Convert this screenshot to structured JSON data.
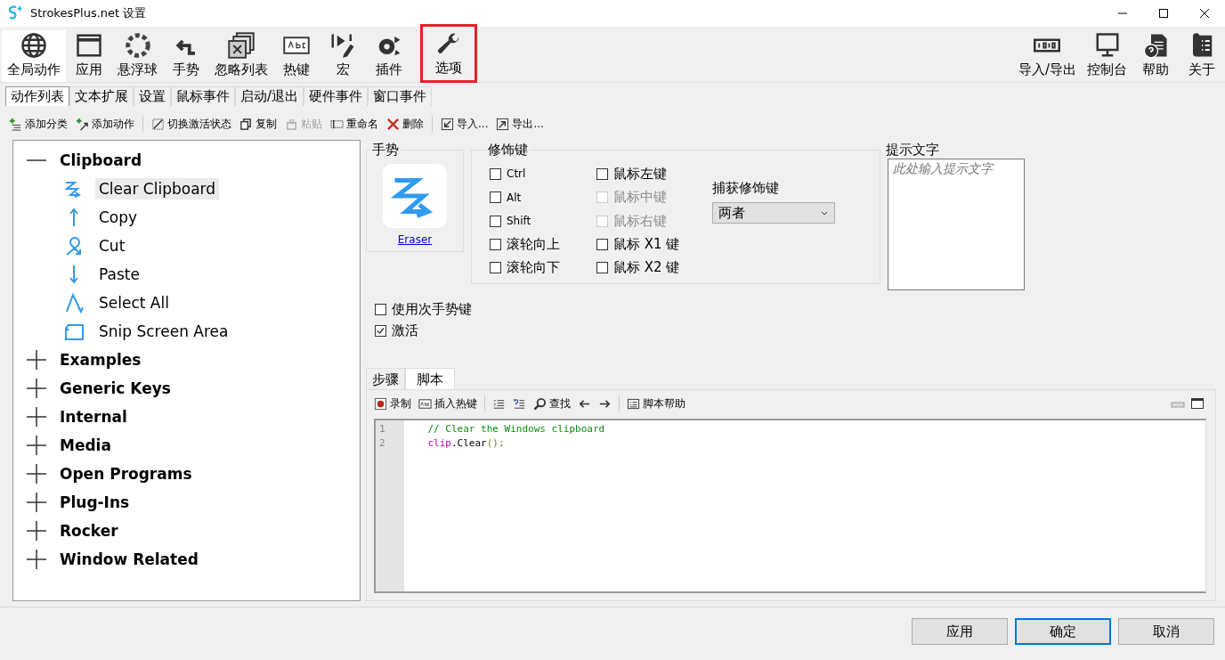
{
  "window": {
    "title": "StrokesPlus.net 设置"
  },
  "toolbar": [
    {
      "label": "全局动作",
      "selected": true,
      "highlighted": false
    },
    {
      "label": "应用",
      "selected": false,
      "highlighted": false
    },
    {
      "label": "悬浮球",
      "selected": false,
      "highlighted": false
    },
    {
      "label": "手势",
      "selected": false,
      "highlighted": false
    },
    {
      "label": "忽略列表",
      "selected": false,
      "highlighted": false
    },
    {
      "label": "热键",
      "selected": false,
      "highlighted": false
    },
    {
      "label": "宏",
      "selected": false,
      "highlighted": false
    },
    {
      "label": "插件",
      "selected": false,
      "highlighted": false
    },
    {
      "label": "选项",
      "selected": false,
      "highlighted": true
    }
  ],
  "toolbar_right": [
    {
      "label": "导入/导出"
    },
    {
      "label": "控制台"
    },
    {
      "label": "帮助"
    },
    {
      "label": "关于"
    }
  ],
  "tabs": [
    {
      "label": "动作列表",
      "selected": true
    },
    {
      "label": "文本扩展",
      "selected": false
    },
    {
      "label": "设置",
      "selected": false
    },
    {
      "label": "鼠标事件",
      "selected": false
    },
    {
      "label": "启动/退出",
      "selected": false
    },
    {
      "label": "硬件事件",
      "selected": false
    },
    {
      "label": "窗口事件",
      "selected": false
    }
  ],
  "actions": [
    {
      "label": "添加分类",
      "disabled": false
    },
    {
      "label": "添加动作",
      "disabled": false
    },
    {
      "label": "切换激活状态",
      "disabled": false
    },
    {
      "label": "复制",
      "disabled": false
    },
    {
      "label": "粘贴",
      "disabled": true
    },
    {
      "label": "重命名",
      "disabled": false
    },
    {
      "label": "删除",
      "disabled": false
    },
    {
      "label": "导入...",
      "disabled": false
    },
    {
      "label": "导出...",
      "disabled": false
    }
  ],
  "tree": [
    {
      "label": "Clipboard",
      "expanded": true,
      "children": [
        {
          "label": "Clear Clipboard",
          "selected": true
        },
        {
          "label": "Copy",
          "selected": false
        },
        {
          "label": "Cut",
          "selected": false
        },
        {
          "label": "Paste",
          "selected": false
        },
        {
          "label": "Select All",
          "selected": false
        },
        {
          "label": "Snip Screen Area",
          "selected": false
        }
      ]
    },
    {
      "label": "Examples",
      "expanded": false
    },
    {
      "label": "Generic Keys",
      "expanded": false
    },
    {
      "label": "Internal",
      "expanded": false
    },
    {
      "label": "Media",
      "expanded": false
    },
    {
      "label": "Open Programs",
      "expanded": false
    },
    {
      "label": "Plug-Ins",
      "expanded": false
    },
    {
      "label": "Rocker",
      "expanded": false
    },
    {
      "label": "Window Related",
      "expanded": false
    }
  ],
  "gesture": {
    "title": "手势",
    "link": "Eraser"
  },
  "modifiers": {
    "title": "修饰键",
    "items": [
      {
        "label": "Ctrl",
        "checked": false,
        "disabled": false
      },
      {
        "label": "Alt",
        "checked": false,
        "disabled": false
      },
      {
        "label": "Shift",
        "checked": false,
        "disabled": false
      },
      {
        "label": "滚轮向上",
        "checked": false,
        "disabled": false
      },
      {
        "label": "滚轮向下",
        "checked": false,
        "disabled": false
      },
      {
        "label": "鼠标左键",
        "checked": false,
        "disabled": false
      },
      {
        "label": "鼠标中键",
        "checked": false,
        "disabled": true
      },
      {
        "label": "鼠标右键",
        "checked": false,
        "disabled": true
      },
      {
        "label": "鼠标 X1 键",
        "checked": false,
        "disabled": false
      },
      {
        "label": "鼠标 X2 键",
        "checked": false,
        "disabled": false
      }
    ]
  },
  "capture": {
    "label": "捕获修饰键",
    "value": "两者"
  },
  "hint": {
    "title": "提示文字",
    "placeholder": "此处输入提示文字"
  },
  "options": [
    {
      "label": "使用次手势键",
      "checked": false
    },
    {
      "label": "激活",
      "checked": true
    }
  ],
  "script_tabs": [
    {
      "label": "步骤",
      "selected": false
    },
    {
      "label": "脚本",
      "selected": true
    }
  ],
  "script_tools": [
    {
      "kind": "labeled",
      "label": "录制"
    },
    {
      "kind": "labeled",
      "label": "插入热键"
    },
    {
      "kind": "icon"
    },
    {
      "kind": "icon"
    },
    {
      "kind": "labeled",
      "label": "查找"
    },
    {
      "kind": "icon"
    },
    {
      "kind": "icon"
    },
    {
      "kind": "labeled",
      "label": "脚本帮助"
    }
  ],
  "code": [
    {
      "number": "1",
      "tokens": [
        {
          "text": "    // Clear the Windows clipboard",
          "kind": "comment"
        }
      ]
    },
    {
      "number": "2",
      "tokens": [
        {
          "text": "    clip",
          "kind": "object"
        },
        {
          "text": ".Clear",
          "kind": "plain"
        },
        {
          "text": "();",
          "kind": "paren"
        }
      ]
    }
  ],
  "buttons": [
    {
      "label": "应用",
      "default": false
    },
    {
      "label": "确定",
      "default": true
    },
    {
      "label": "取消",
      "default": false
    }
  ]
}
